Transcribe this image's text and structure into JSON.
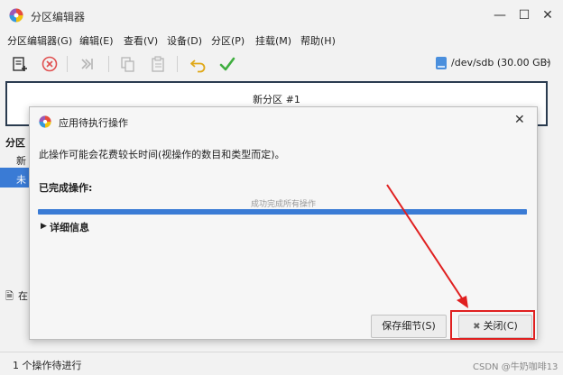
{
  "window": {
    "title": "分区编辑器",
    "minimize": "—",
    "maximize": "☐",
    "close": "✕"
  },
  "menu": [
    "分区编辑器(G)",
    "编辑(E)",
    "查看(V)",
    "设备(D)",
    "分区(P)",
    "挂载(M)",
    "帮助(H)"
  ],
  "device_selector": {
    "label": "/dev/sdb (30.00 GB)"
  },
  "partition_map": {
    "label": "新分区 #1"
  },
  "partition_list": {
    "header": "分区",
    "row1": "新",
    "row2": "未"
  },
  "side_info": {
    "icon": "🗎",
    "text": "在"
  },
  "statusbar": {
    "text": "1 个操作待进行"
  },
  "watermark": "CSDN @牛奶咖啡13",
  "dialog": {
    "title": "应用待执行操作",
    "close": "✕",
    "message": "此操作可能会花费较长时间(视操作的数目和类型而定)。",
    "completed_label": "已完成操作:",
    "progress_text": "成功完成所有操作",
    "progress": 1.0,
    "details_toggle": "▶",
    "details_label": "详细信息",
    "save_button": "保存细节(S)",
    "close_button_icon": "✖",
    "close_button": "关闭(C)"
  },
  "colors": {
    "accent": "#3a7bd5",
    "annotation": "#e02020"
  }
}
